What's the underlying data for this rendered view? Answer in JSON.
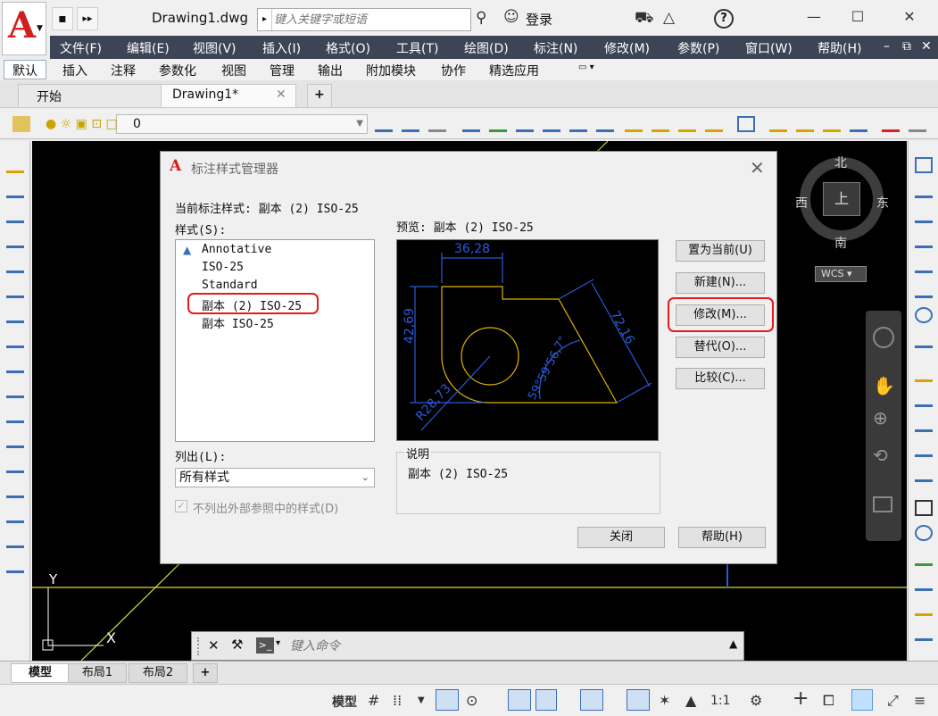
{
  "title_bar": {
    "document_title": "Drawing1.dwg",
    "search_placeholder": "键入关键字或短语",
    "login_label": "登录",
    "help_label": "?"
  },
  "menu": [
    "文件(F)",
    "编辑(E)",
    "视图(V)",
    "插入(I)",
    "格式(O)",
    "工具(T)",
    "绘图(D)",
    "标注(N)",
    "修改(M)",
    "参数(P)",
    "窗口(W)",
    "帮助(H)"
  ],
  "ribbon_tabs": [
    "默认",
    "插入",
    "注释",
    "参数化",
    "视图",
    "管理",
    "输出",
    "附加模块",
    "协作",
    "精选应用"
  ],
  "doc_tabs": {
    "start": "开始",
    "drawing": "Drawing1*",
    "new": "+"
  },
  "layer": {
    "current": "0"
  },
  "viewcube": {
    "north": "北",
    "south": "南",
    "east": "东",
    "west": "西",
    "top": "上",
    "wcs": "WCS"
  },
  "ucs": {
    "y_label": "Y",
    "x_label": "X"
  },
  "command_line": {
    "placeholder": "键入命令"
  },
  "layout_tabs": [
    "模型",
    "布局1",
    "布局2",
    "+"
  ],
  "status_bar": {
    "model_label": "模型",
    "scale": "1:1"
  },
  "dialog": {
    "title": "标注样式管理器",
    "current_style_label": "当前标注样式: 副本 (2) ISO-25",
    "styles_label": "样式(S):",
    "styles": [
      "Annotative",
      "ISO-25",
      "Standard",
      "副本 (2) ISO-25",
      "副本 ISO-25"
    ],
    "preview_label": "预览: 副本 (2) ISO-25",
    "list_label": "列出(L):",
    "list_value": "所有样式",
    "exclude_xref_label": "不列出外部参照中的样式(D)",
    "description_label": "说明",
    "description_value": "副本 (2) ISO-25",
    "buttons": {
      "set_current": "置为当前(U)",
      "new": "新建(N)...",
      "modify": "修改(M)...",
      "override": "替代(O)...",
      "compare": "比较(C)...",
      "close": "关闭",
      "help": "帮助(H)"
    },
    "preview_dims": {
      "d1": "36,28",
      "d2": "42,69",
      "d3": "72,16",
      "d4": "R28,73",
      "d5": "59°59'56,7\""
    }
  }
}
